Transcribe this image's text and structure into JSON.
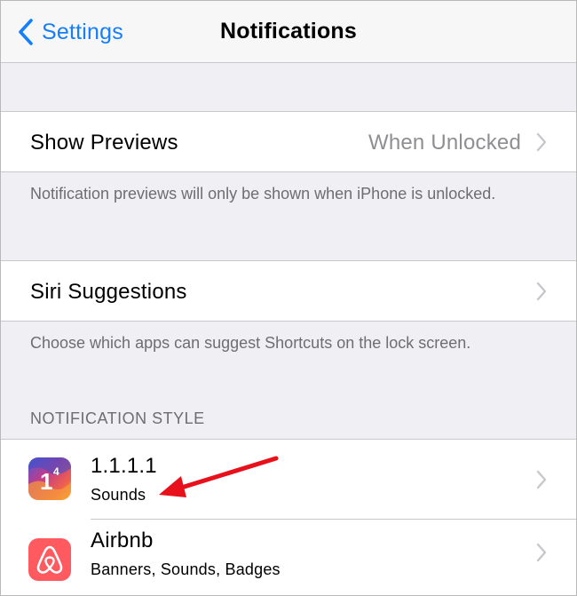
{
  "navbar": {
    "back_label": "Settings",
    "title": "Notifications"
  },
  "show_previews": {
    "label": "Show Previews",
    "value": "When Unlocked",
    "footer": "Notification previews will only be shown when iPhone is unlocked."
  },
  "siri_suggestions": {
    "label": "Siri Suggestions",
    "footer": "Choose which apps can suggest Shortcuts on the lock screen."
  },
  "notification_style": {
    "header": "NOTIFICATION STYLE",
    "apps": [
      {
        "name": "1.1.1.1",
        "subtitle": "Sounds",
        "icon": "cloudflare-1111-icon"
      },
      {
        "name": "Airbnb",
        "subtitle": "Banners, Sounds, Badges",
        "icon": "airbnb-icon"
      }
    ]
  },
  "colors": {
    "accent": "#147efb",
    "background": "#efeff4",
    "airbnb": "#ff5a5f",
    "annotation_arrow": "#e8101a"
  }
}
